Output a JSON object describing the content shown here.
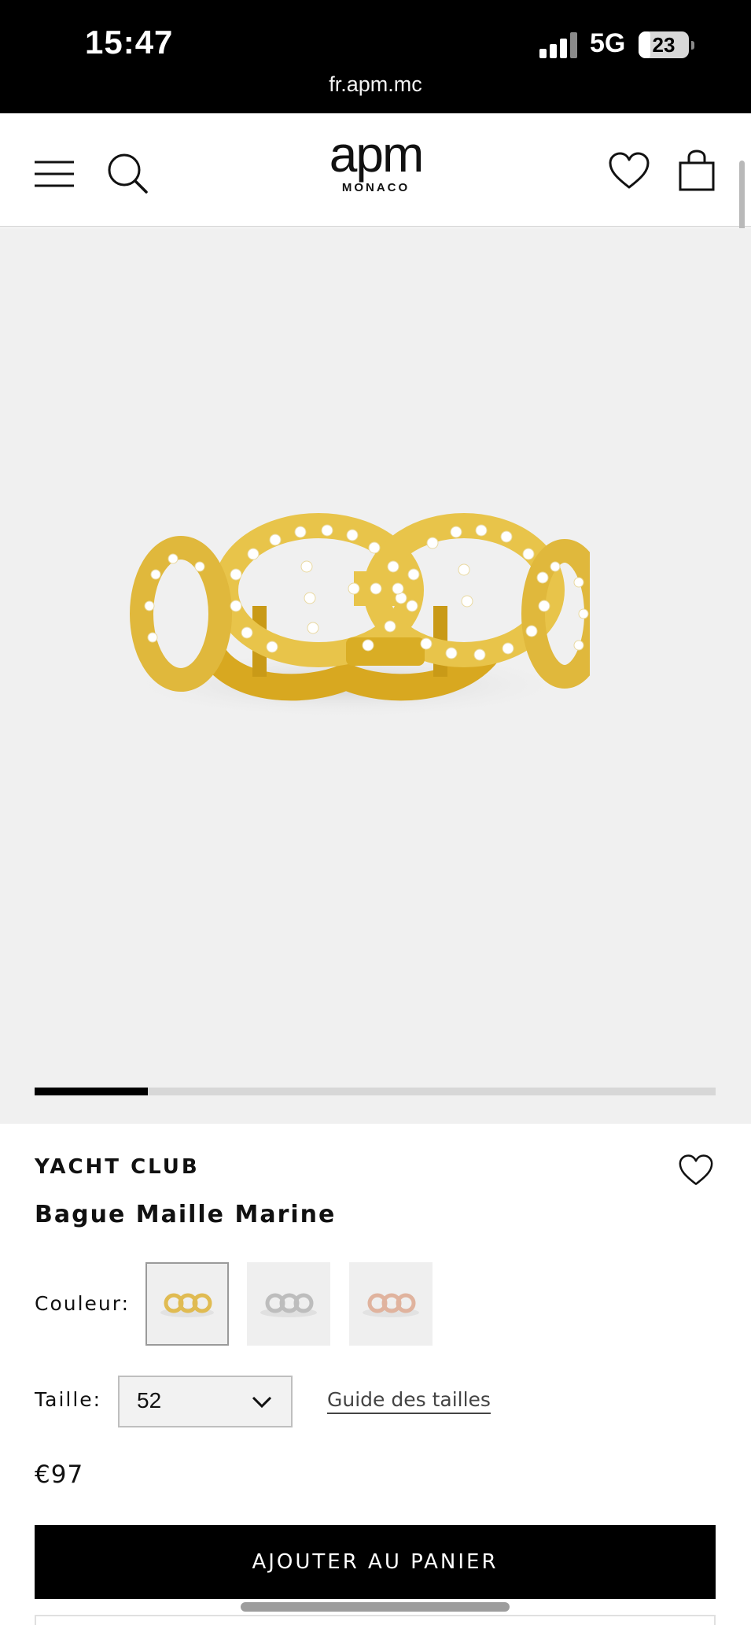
{
  "status_bar": {
    "time": "15:47",
    "network": "5G",
    "battery_level": "23",
    "battery_fraction": 0.23,
    "url": "fr.apm.mc"
  },
  "header": {
    "brand_logo": "apm",
    "brand_sub": "MONACO",
    "icons": [
      "menu-icon",
      "search-icon",
      "heart-icon",
      "bag-icon"
    ]
  },
  "gallery": {
    "image_alt": "Bague Maille Marine",
    "current_image": 1,
    "progress_fraction": 0.166
  },
  "product": {
    "collection": "YACHT CLUB",
    "name": "Bague Maille Marine",
    "color_label": "Couleur:",
    "colors": [
      {
        "name": "gold",
        "hex": "#e8c44a",
        "selected": true
      },
      {
        "name": "silver",
        "hex": "#c9c9c9",
        "selected": false
      },
      {
        "name": "rose",
        "hex": "#e4b9a4",
        "selected": false
      }
    ],
    "size_label": "Taille:",
    "size_value": "52",
    "size_guide": "Guide des tailles",
    "price": "€97",
    "add_to_cart": "AJOUTER AU PANIER"
  }
}
